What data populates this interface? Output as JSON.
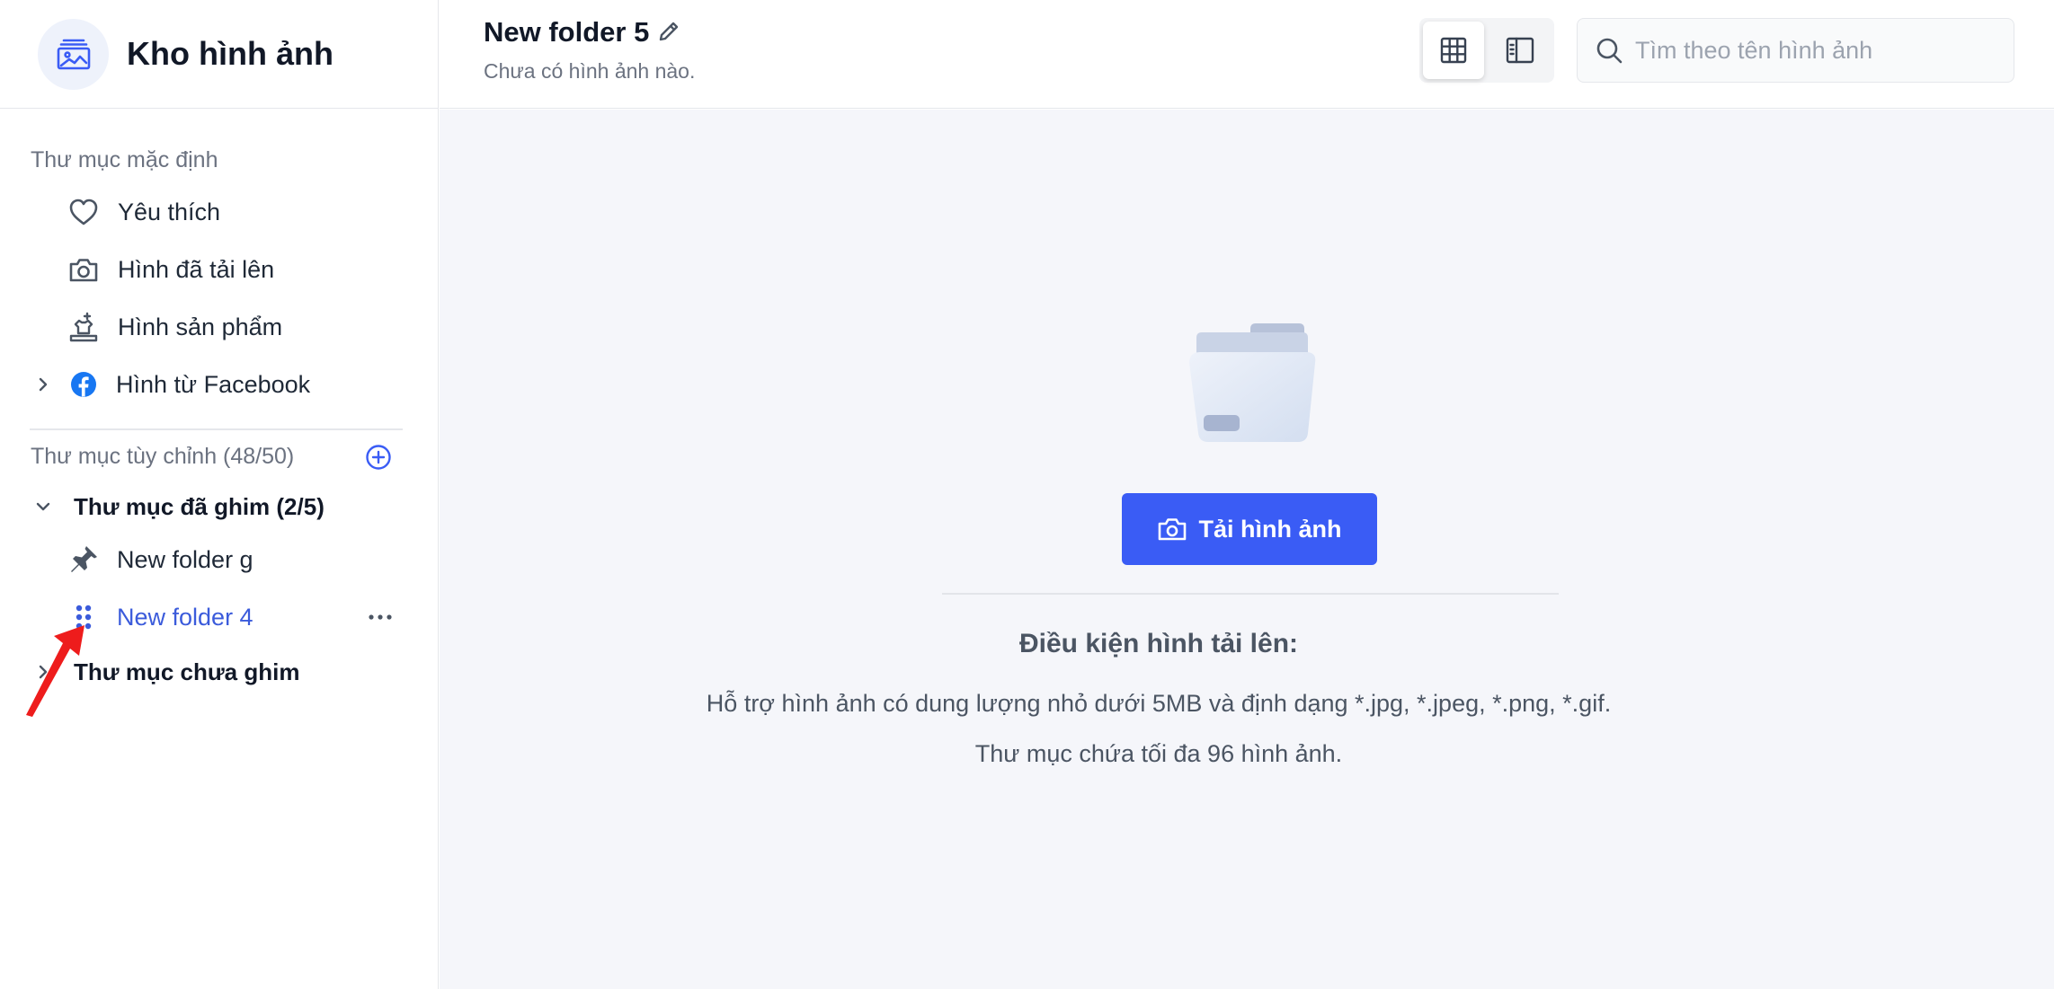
{
  "brand": {
    "title": "Kho hình ảnh"
  },
  "sidebar": {
    "default_section_title": "Thư mục mặc định",
    "default_items": [
      {
        "label": "Yêu thích",
        "icon": "heart-icon"
      },
      {
        "label": "Hình đã tải lên",
        "icon": "camera-icon"
      },
      {
        "label": "Hình sản phẩm",
        "icon": "product-icon"
      },
      {
        "label": "Hình từ Facebook",
        "icon": "facebook-icon"
      }
    ],
    "custom_section_title": "Thư mục tùy chỉnh (48/50)",
    "pinned_group_label": "Thư mục đã ghim (2/5)",
    "pinned_items": [
      {
        "label": "New folder g",
        "icon": "pin-icon"
      },
      {
        "label": "New folder 4",
        "icon": "drag-handle-icon"
      }
    ],
    "unpinned_group_label": "Thư mục chưa ghim"
  },
  "header": {
    "folder_name": "New folder 5",
    "folder_subtitle": "Chưa có hình ảnh nào.",
    "search_placeholder": "Tìm theo tên hình ảnh"
  },
  "main": {
    "upload_label": "Tải hình ảnh",
    "conditions_title": "Điều kiện hình tải lên:",
    "conditions_line1": "Hỗ trợ hình ảnh có dung lượng nhỏ dưới 5MB và định dạng *.jpg, *.jpeg, *.png, *.gif.",
    "conditions_line2": "Thư mục chứa tối đa 96 hình ảnh."
  },
  "colors": {
    "accent": "#3a5cf5",
    "active_item": "#3b5bdb",
    "annotation": "#ee1c1c"
  }
}
